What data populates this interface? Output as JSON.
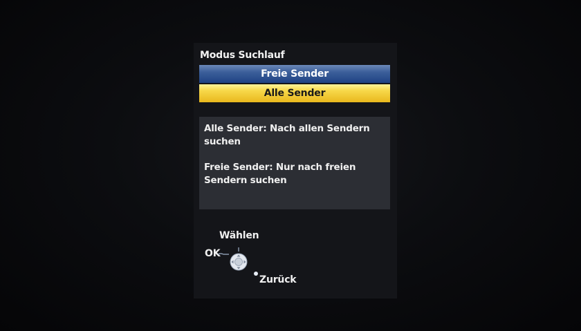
{
  "dialog": {
    "title": "Modus Suchlauf",
    "options": [
      {
        "label": "Freie Sender",
        "state": "unselected"
      },
      {
        "label": "Alle Sender",
        "state": "highlighted"
      }
    ],
    "info": {
      "line1": "Alle Sender: Nach allen Sendern suchen",
      "line2": "Freie Sender: Nur nach freien Sendern suchen"
    }
  },
  "navigation_hint": {
    "select_label": "Wählen",
    "ok_label": "OK",
    "back_label": "Zurück",
    "icon": "remote-dpad-icon"
  },
  "colors": {
    "background": "#070709",
    "panel": "#141519",
    "info_box": "#2c2e34",
    "option_blue": "#2f5190",
    "option_yellow": "#f2cc3c",
    "text": "#f0f0f0"
  }
}
